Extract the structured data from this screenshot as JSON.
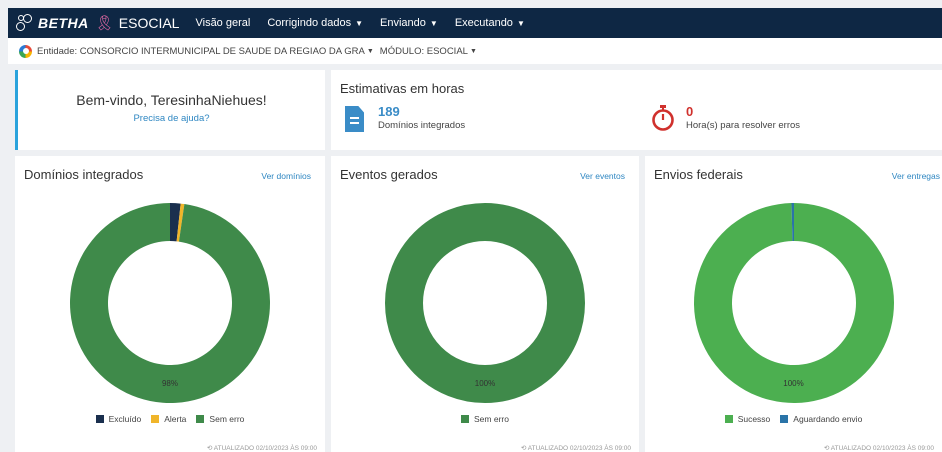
{
  "header": {
    "brand": "BETHA",
    "product": "ESOCIAL",
    "nav": [
      "Visão geral",
      "Corrigindo dados",
      "Enviando",
      "Executando"
    ]
  },
  "context": {
    "entity": "Entidade: CONSORCIO INTERMUNICIPAL DE SAUDE DA REGIAO DA GRA",
    "module": "MÓDULO: ESOCIAL"
  },
  "welcome": {
    "greeting": "Bem-vindo, TeresinhaNiehues!",
    "help_link": "Precisa de ajuda?"
  },
  "estimates": {
    "title": "Estimativas em horas",
    "domains_value": "189",
    "domains_label": "Domínios integrados",
    "hours_value": "0",
    "hours_label": "Hora(s) para resolver erros"
  },
  "colors": {
    "dark_green": "#3f8a4a",
    "light_green": "#4caf50",
    "navy": "#1a2f4e",
    "yellow": "#f0b52a",
    "blue": "#2a74a8"
  },
  "panels": [
    {
      "title": "Domínios integrados",
      "link": "Ver domínios",
      "center_label": "98%",
      "legend": [
        "Excluído",
        "Alerta",
        "Sem erro"
      ],
      "updated": "⟲ ATUALIZADO 02/10/2023 ÀS 09:00",
      "chart_data": {
        "type": "pie",
        "categories": [
          "Excluído",
          "Alerta",
          "Sem erro"
        ],
        "values": [
          1.7,
          0.6,
          97.7
        ],
        "colors": [
          "#1a2f4e",
          "#f0b52a",
          "#3f8a4a"
        ]
      }
    },
    {
      "title": "Eventos gerados",
      "link": "Ver eventos",
      "center_label": "100%",
      "legend": [
        "Sem erro"
      ],
      "updated": "⟲ ATUALIZADO 02/10/2023 ÀS 09:00",
      "chart_data": {
        "type": "pie",
        "categories": [
          "Sem erro"
        ],
        "values": [
          100
        ],
        "colors": [
          "#3f8a4a"
        ]
      }
    },
    {
      "title": "Envios federais",
      "link": "Ver entregas",
      "center_label": "100%",
      "legend": [
        "Sucesso",
        "Aguardando envio"
      ],
      "updated": "⟲ ATUALIZADO 02/10/2023 ÀS 09:00",
      "chart_data": {
        "type": "pie",
        "categories": [
          "Sucesso",
          "Aguardando envio"
        ],
        "values": [
          99.6,
          0.4
        ],
        "colors": [
          "#4caf50",
          "#2a74a8"
        ]
      }
    }
  ]
}
